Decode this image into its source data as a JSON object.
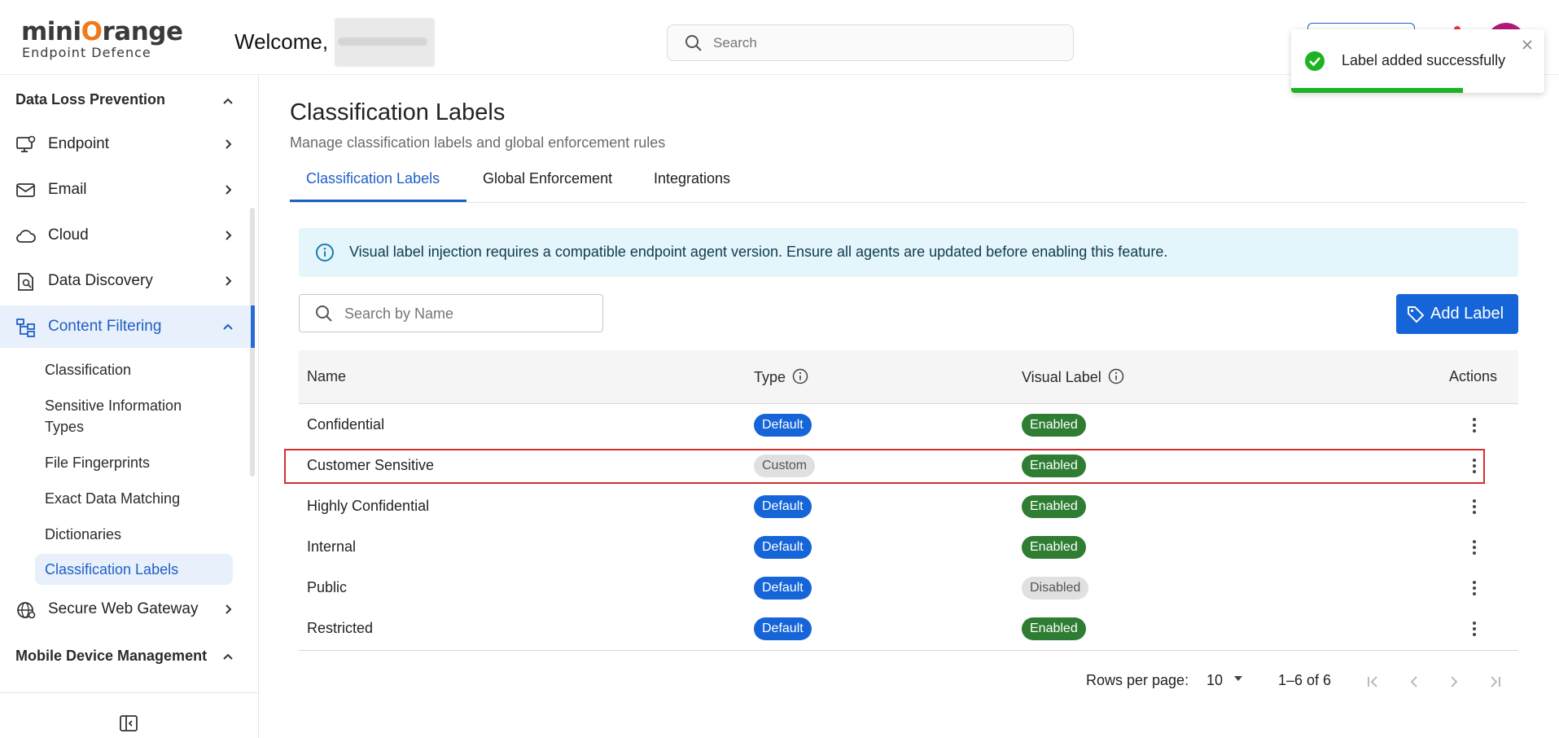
{
  "header": {
    "logo_main_a": "mini",
    "logo_main_o": "O",
    "logo_main_b": "range",
    "logo_sub": "Endpoint Defence",
    "welcome": "Welcome,",
    "search_placeholder": "Search"
  },
  "toast": {
    "message": "Label added successfully",
    "progress": 0.68,
    "accent_color": "#1db322"
  },
  "sidebar": {
    "section_dlp": "Data Loss Prevention",
    "items": [
      {
        "label": "Endpoint",
        "icon": "monitor-gear-icon"
      },
      {
        "label": "Email",
        "icon": "mail-icon"
      },
      {
        "label": "Cloud",
        "icon": "cloud-icon"
      },
      {
        "label": "Data Discovery",
        "icon": "file-search-icon"
      },
      {
        "label": "Content Filtering",
        "icon": "filter-tree-icon"
      }
    ],
    "sub_items": [
      "Classification",
      "Sensitive Information Types",
      "File Fingerprints",
      "Exact Data Matching",
      "Dictionaries",
      "Classification Labels"
    ],
    "swg": {
      "label": "Secure Web Gateway",
      "icon": "globe-gear-icon"
    },
    "section_mdm": "Mobile Device Management"
  },
  "main": {
    "title": "Classification Labels",
    "subtitle": "Manage classification labels and global enforcement rules",
    "tabs": [
      "Classification Labels",
      "Global Enforcement",
      "Integrations"
    ],
    "info_text": "Visual label injection requires a compatible endpoint agent version. Ensure all agents are updated before enabling this feature.",
    "filter_placeholder": "Search by Name",
    "add_button": "Add Label"
  },
  "table": {
    "columns": [
      "Name",
      "Type",
      "Visual Label",
      "Actions"
    ],
    "rows": [
      {
        "name": "Confidential",
        "type": "Default",
        "visual": "Enabled"
      },
      {
        "name": "Customer Sensitive",
        "type": "Custom",
        "visual": "Enabled"
      },
      {
        "name": "Highly Confidential",
        "type": "Default",
        "visual": "Enabled"
      },
      {
        "name": "Internal",
        "type": "Default",
        "visual": "Enabled"
      },
      {
        "name": "Public",
        "type": "Default",
        "visual": "Disabled"
      },
      {
        "name": "Restricted",
        "type": "Default",
        "visual": "Enabled"
      }
    ]
  },
  "pagination": {
    "rows_per_page_label": "Rows per page:",
    "rows_per_page": "10",
    "range": "1–6 of 6"
  },
  "colors": {
    "primary": "#1565d8",
    "enabled": "#2e7d32",
    "highlight": "#d32f2f",
    "info_bg": "#e4f5fc"
  }
}
